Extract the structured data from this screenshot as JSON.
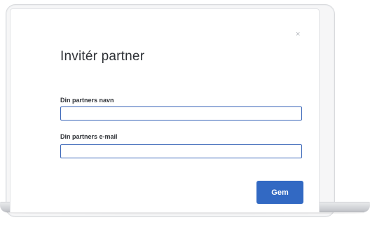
{
  "dialog": {
    "title": "Invitér partner",
    "close_icon": "×",
    "fields": {
      "name": {
        "label": "Din partners navn",
        "value": "",
        "placeholder": ""
      },
      "email": {
        "label": "Din partners e-mail",
        "value": "",
        "placeholder": ""
      }
    },
    "save_label": "Gem"
  },
  "colors": {
    "accent": "#3269c3",
    "field_border": "#3a66b8",
    "title_text": "#2e3136"
  },
  "icons": {
    "close": "close-icon"
  }
}
